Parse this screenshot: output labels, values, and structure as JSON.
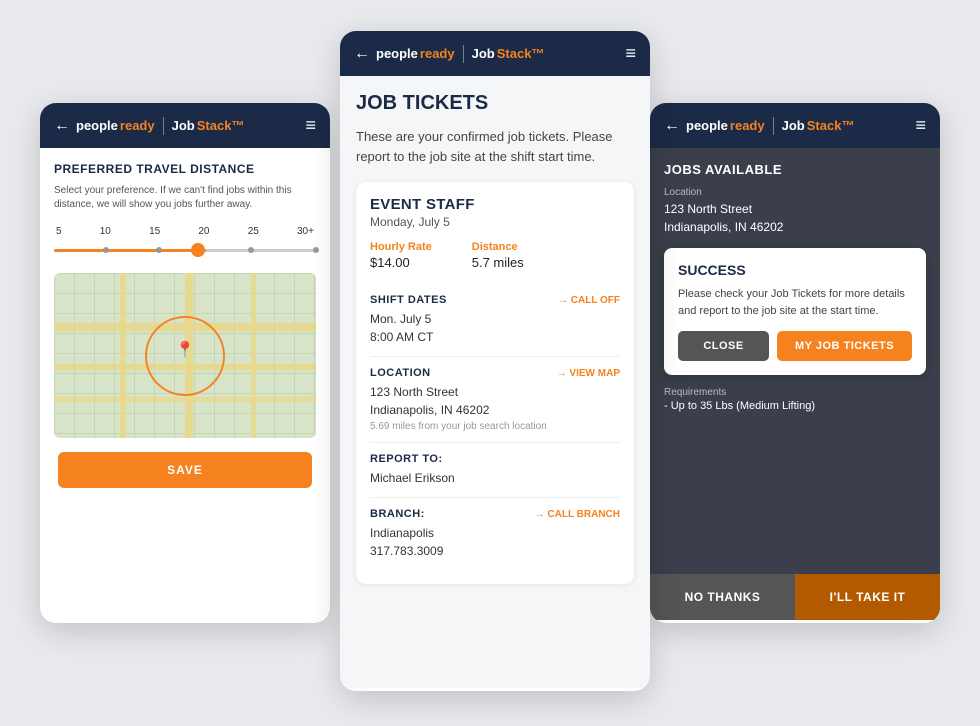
{
  "left": {
    "nav": {
      "back": "←",
      "logo_people": "people",
      "logo_ready": "ready",
      "logo_job": "Job",
      "logo_stack": "Stack™",
      "hamburger": "≡"
    },
    "title": "PREFERRED TRAVEL DISTANCE",
    "description": "Select your preference. If we can't find jobs within this distance, we will show you jobs further away.",
    "slider_labels": [
      "5",
      "10",
      "15",
      "20",
      "25",
      "30+"
    ],
    "save_button": "SAVE"
  },
  "center": {
    "nav": {
      "back": "←",
      "logo_people": "people",
      "logo_ready": "ready",
      "logo_job": "Job",
      "logo_stack": "Stack™",
      "hamburger": "≡"
    },
    "page_title": "JOB TICKETS",
    "description": "These are your confirmed job tickets. Please report to the job site at the shift start time.",
    "ticket": {
      "job_title": "EVENT STAFF",
      "job_date": "Monday, July 5",
      "hourly_rate_label": "Hourly Rate",
      "hourly_rate_value": "$14.00",
      "distance_label": "Distance",
      "distance_value": "5.7 miles",
      "shift_dates_label": "SHIFT DATES",
      "shift_dates_action": "→ CALL OFF",
      "shift_dates_value": "Mon. July 5",
      "shift_dates_time": "8:00 AM CT",
      "location_label": "LOCATION",
      "location_action": "→ VIEW MAP",
      "location_street": "123 North Street",
      "location_city": "Indianapolis, IN 46202",
      "location_distance": "5.69 miles from your job search location",
      "report_label": "REPORT TO:",
      "report_value": "Michael Erikson",
      "branch_label": "BRANCH:",
      "branch_action": "→ CALL BRANCH",
      "branch_city": "Indianapolis",
      "branch_phone": "317.783.3009"
    }
  },
  "right": {
    "nav": {
      "back": "←",
      "logo_people": "people",
      "logo_ready": "ready",
      "logo_job": "Job",
      "logo_stack": "Stack™",
      "hamburger": "≡"
    },
    "section_title": "JOBS AVAILABLE",
    "location_label": "Location",
    "location_street": "123 North Street",
    "location_city": "Indianapolis, IN 46202",
    "success_modal": {
      "title": "SUCCESS",
      "description": "Please check your Job Tickets for more details and report to the job site at the start time.",
      "close_button": "CLOSE",
      "my_tickets_button": "MY JOB TICKETS"
    },
    "requirements_label": "Requirements",
    "requirements_value": "- Up to 35 Lbs (Medium Lifting)",
    "no_thanks_button": "NO THANKS",
    "ill_take_it_button": "I'LL TAKE IT"
  }
}
